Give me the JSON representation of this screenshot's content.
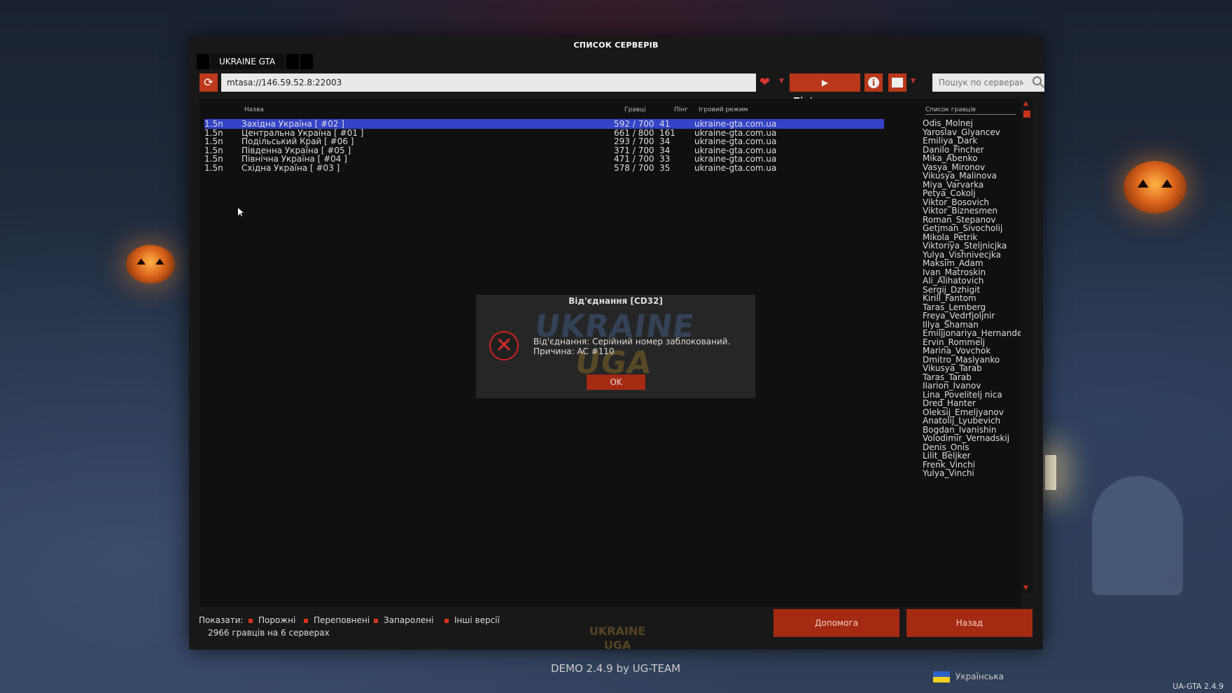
{
  "window": {
    "title": "СПИСОК СЕРВЕРІВ",
    "tab_label": "UKRAINE GTA"
  },
  "toolbar": {
    "refresh_icon": "refresh-icon",
    "url_value": "mtasa://146.59.52.8:22003",
    "favorite_icon": "heart-icon",
    "connect_label": "Під'єднатися",
    "info_icon": "info-icon",
    "image_icon": "image-icon",
    "search_placeholder": "Пошук по серверам..."
  },
  "columns": {
    "name": "Назва",
    "players": "Гравці",
    "ping": "Пінг",
    "mode": "Ігровий режим",
    "player_list": "Список гравців"
  },
  "servers": [
    {
      "version": "1.5n",
      "name": "Західна Україна [ #02 ]",
      "players": "592 / 700",
      "ping": "41",
      "mode": "ukraine-gta.com.ua",
      "selected": true
    },
    {
      "version": "1.5n",
      "name": "Центральна Україна [ #01 ]",
      "players": "661 / 800",
      "ping": "161",
      "mode": "ukraine-gta.com.ua"
    },
    {
      "version": "1.5n",
      "name": "Подільський Край [ #06 ]",
      "players": "293 / 700",
      "ping": "34",
      "mode": "ukraine-gta.com.ua"
    },
    {
      "version": "1.5n",
      "name": "Південна Україна [ #05 ]",
      "players": "371 / 700",
      "ping": "34",
      "mode": "ukraine-gta.com.ua"
    },
    {
      "version": "1.5n",
      "name": "Північна Україна [ #04 ]",
      "players": "471 / 700",
      "ping": "33",
      "mode": "ukraine-gta.com.ua"
    },
    {
      "version": "1.5n",
      "name": "Східна Україна [ #03 ]",
      "players": "578 / 700",
      "ping": "35",
      "mode": "ukraine-gta.com.ua"
    }
  ],
  "players": [
    "Odis_Molnej",
    "Yaroslav_Glyancev",
    "Emiliya_Dark",
    "Danilo_Fincher",
    "Mika_Abenko",
    "Vasya_Mironov",
    "Vikusya_Malinova",
    "Miya_Varvarka",
    "Petya_Cokolj",
    "Viktor_Bosovich",
    "Viktor_Biznesmen",
    "Roman_Stepanov",
    "Getjman_Sivocholij",
    "Mikola_Petrik",
    "Viktoriya_Steljnicjka",
    "Yulya_Vishnivecjka",
    "Maksim_Adam",
    "Ivan_Matroskin",
    "Ali_Alihatovich",
    "Sergij_Dzhigit",
    "Kirill_Fantom",
    "Taras_Lemberg",
    "Freya_Vedrfjoljnir",
    "Illya_Shaman",
    "Emiljjonariya_Hernande",
    "Ervin_Rommelj",
    "Marina_Vovchok",
    "Dmitro_Maslyanko",
    "Vikusya_Tarab",
    "Taras_Tarab",
    "Ilarion_Ivanov",
    "Lina_Povelitelj nica",
    "Dred_Hanter",
    "Oleksij_Emeljyanov",
    "Anatolij_Lyubevich",
    "Bogdan_Ivanishin",
    "Volodimir_Vernadskij",
    "Denis_Onis",
    "Lilit_Beljker",
    "Frenk_Vinchi",
    "Yulya_Vinchi"
  ],
  "footer": {
    "show_label": "Показати:",
    "filters": [
      "Порожні",
      "Переповнені",
      "Запаролені",
      "Інші версії"
    ],
    "summary": "2966 гравців на 6 серверах",
    "help_label": "Допомога",
    "back_label": "Назад"
  },
  "dialog": {
    "title": "Від'єднання [CD32]",
    "line1": "Від'єднання: Серійний номер заблокований.",
    "line2": "Причина: AC #110",
    "ok_label": "OK",
    "watermark_top": "UKRAINE",
    "watermark_bottom": "UGA",
    "icon": "error-x-icon"
  },
  "bottom": {
    "demo": "DEMO 2.4.9 by UG-TEAM",
    "language": "Українська",
    "corner_version": "UA-GTA 2.4.9",
    "logo_text": "UKRAINE UGA"
  },
  "colors": {
    "accent": "#b9371b",
    "selected_row": "#3443c8",
    "window_bg": "#181818"
  }
}
